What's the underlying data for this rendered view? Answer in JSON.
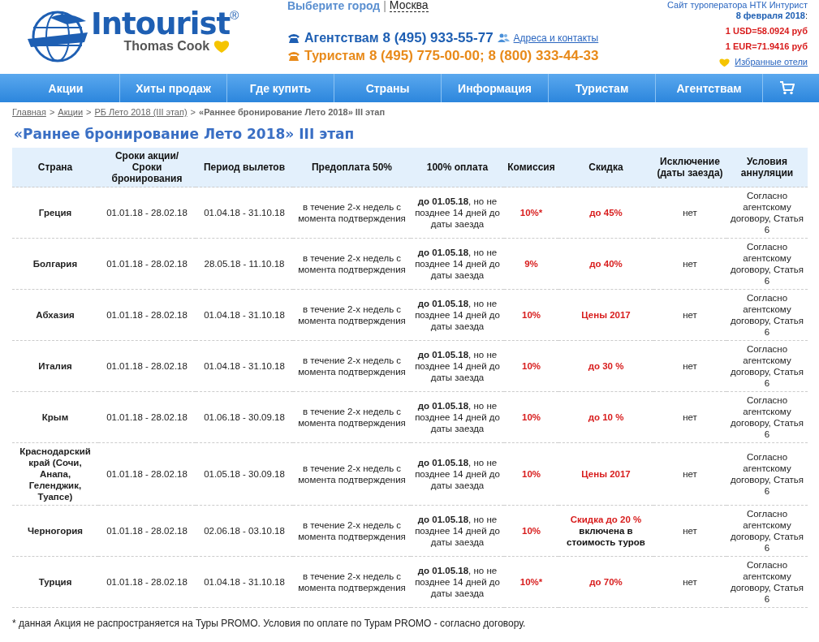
{
  "header": {
    "brand": "Intourist",
    "brand_mark": "®",
    "brand_sub": "Thomas Cook",
    "city_prompt": "Выберите город",
    "city_separator": "|",
    "city": "Москва",
    "phones": [
      {
        "kind": "agents",
        "label": "Агентствам",
        "number": "8 (495) 933-55-77",
        "link": "Адреса и контакты"
      },
      {
        "kind": "tourists",
        "label": "Туристам",
        "number": "8 (495) 775-00-00; 8 (800) 333-44-33"
      }
    ],
    "site_note": "Сайт туроператора НТК Интурист",
    "date": "8 февраля 2018",
    "date_suffix": ":",
    "rates": [
      "1 USD=58.0924 руб",
      "1 EUR=71.9416 руб"
    ],
    "favorites": "Избранные отели"
  },
  "nav": [
    "Акции",
    "Хиты продаж",
    "Где купить",
    "Страны",
    "Информация",
    "Туристам",
    "Агентствам"
  ],
  "breadcrumbs": [
    {
      "label": "Главная",
      "link": true
    },
    {
      "label": "Акции",
      "link": true
    },
    {
      "label": "РБ Лето 2018 (III этап)",
      "link": true
    },
    {
      "label": "«Раннее бронирование Лето 2018» III этап",
      "link": false
    }
  ],
  "breadcrumb_separator": ">",
  "title": "«Раннее бронирование Лето 2018» III этап",
  "table": {
    "columns": [
      "Страна",
      "Сроки акции/ Сроки бронирования",
      "Период вылетов",
      "Предоплата 50%",
      "100% оплата",
      "Комиссия",
      "Скидка",
      "Исключение (даты заезда)",
      "Условия аннуляции"
    ],
    "rows": [
      {
        "country": "Греция",
        "booking": "01.01.18 - 28.02.18",
        "period": "01.04.18 - 31.10.18",
        "prepay": "в течение 2-х недель с момента подтверждения",
        "full": "**до 01.05.18**, но не позднее 14 дней до даты заезда",
        "commission": "10%*",
        "discount": "до 45%",
        "exclusion": "нет",
        "cancellation": "Согласно агентскому договору, Статья 6"
      },
      {
        "country": "Болгария",
        "booking": "01.01.18 - 28.02.18",
        "period": "28.05.18 - 11.10.18",
        "prepay": "в течение 2-х недель с момента подтверждения",
        "full": "**до 01.05.18**, но не позднее 14 дней до даты заезда",
        "commission": "9%",
        "discount": "до 40%",
        "exclusion": "нет",
        "cancellation": "Согласно агентскому договору, Статья 6"
      },
      {
        "country": "Абхазия",
        "booking": "01.01.18 - 28.02.18",
        "period": "01.04.18 - 31.10.18",
        "prepay": "в течение 2-х недель с момента подтверждения",
        "full": "**до 01.05.18**, но не позднее 14 дней до даты заезда",
        "commission": "10%",
        "discount": "Цены 2017",
        "exclusion": "нет",
        "cancellation": "Согласно агентскому договору, Статья 6"
      },
      {
        "country": "Италия",
        "booking": "01.01.18 - 28.02.18",
        "period": "01.04.18 - 31.10.18",
        "prepay": "в течение 2-х недель с момента подтверждения",
        "full": "**до 01.05.18**, но не позднее 14 дней до даты заезда",
        "commission": "10%",
        "discount": "до 30 %",
        "exclusion": "нет",
        "cancellation": "Согласно агентскому договору, Статья 6"
      },
      {
        "country": "Крым",
        "booking": "01.01.18 - 28.02.18",
        "period": "01.06.18 - 30.09.18",
        "prepay": "в течение 2-х недель с момента подтверждения",
        "full": "**до 01.05.18**, но не позднее 14 дней до даты заезда",
        "commission": "10%",
        "discount": "до 10 %",
        "exclusion": "нет",
        "cancellation": "Согласно агентскому договору, Статья 6"
      },
      {
        "country": "Краснодарский край (Сочи, Анапа, Геленджик, Туапсе)",
        "booking": "01.01.18 - 28.02.18",
        "period": "01.05.18 - 30.09.18",
        "prepay": "в течение 2-х недель с момента подтверждения",
        "full": "**до 01.05.18**, но не позднее 14 дней до даты заезда",
        "commission": "10%",
        "discount": "Цены 2017",
        "exclusion": "нет",
        "cancellation": "Согласно агентскому договору, Статья 6"
      },
      {
        "country": "Черногория",
        "booking": "01.01.18 - 28.02.18",
        "period": "02.06.18 - 03.10.18",
        "prepay": "в течение 2-х недель с момента подтверждения",
        "full": "**до 01.05.18**, но не позднее 14 дней до даты заезда",
        "commission": "10%",
        "discount": "Скидка до 20 %",
        "discount_note": "включена в стоимость туров",
        "exclusion": "нет",
        "cancellation": "Согласно агентскому договору, Статья 6"
      },
      {
        "country": "Турция",
        "booking": "01.01.18 - 28.02.18",
        "period": "01.04.18 - 31.10.18",
        "prepay": "в течение 2-х недель с момента подтверждения",
        "full": "**до 01.05.18**, но не позднее 14 дней до даты заезда",
        "commission": "10%*",
        "discount": "до 70%",
        "exclusion": "нет",
        "cancellation": "Согласно агентскому договору, Статья 6"
      }
    ]
  },
  "footnote": "* данная Акция не распространяется на Туры PROMO. Условия по оплате по Турам PROMO - согласно договору."
}
